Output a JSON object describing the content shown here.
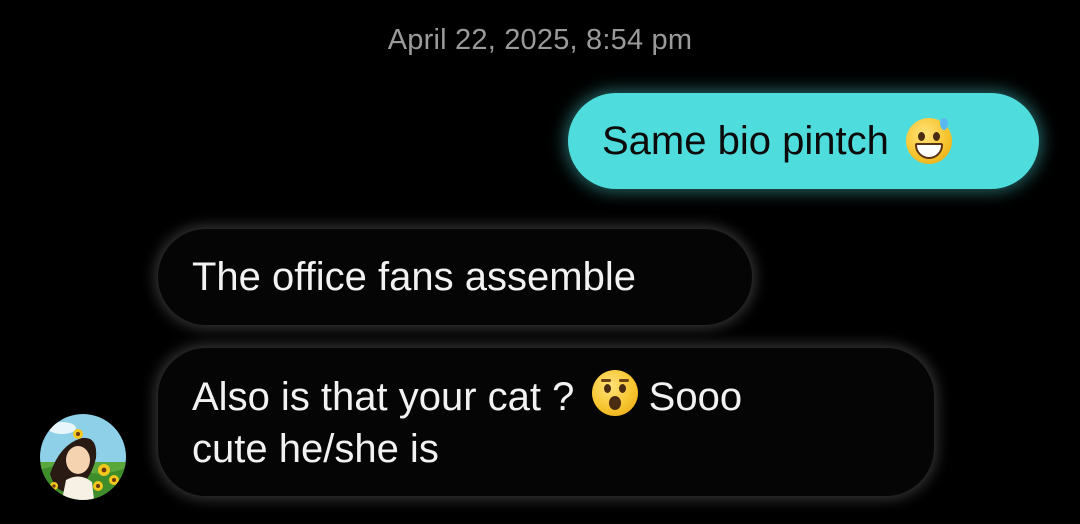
{
  "conversation": {
    "timestamp": "April 22, 2025, 8:54 pm",
    "messages": [
      {
        "direction": "outgoing",
        "text": "Same bio pintch",
        "emoji": "grinning-face-with-sweat-emoji"
      },
      {
        "direction": "incoming",
        "text": "The office fans assemble"
      },
      {
        "direction": "incoming",
        "text_before_emoji": "Also is that your cat ?",
        "emoji": "astonished-face-emoji",
        "text_after_emoji": "Sooo",
        "text_second_line": "cute he/she is"
      }
    ]
  },
  "avatar": {
    "icon": "contact-avatar-sunflower-illustration"
  },
  "colors": {
    "background": "#000000",
    "outgoing_bubble": "#4fdcdc",
    "incoming_bubble": "#050505",
    "timestamp_text": "#9a9a9a"
  }
}
